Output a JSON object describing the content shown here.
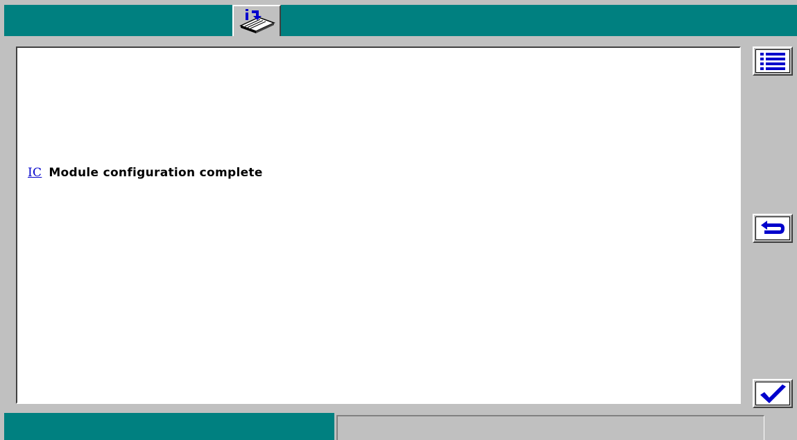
{
  "header": {
    "tab_icon": "info-book-icon"
  },
  "message": {
    "code": "IC",
    "text": "Module configuration complete"
  },
  "side_buttons": [
    {
      "icon": "list-icon"
    },
    {
      "icon": "back-arrow-icon"
    },
    {
      "icon": "checkmark-icon"
    }
  ],
  "status": {
    "left_text": "",
    "right_text": ""
  },
  "colors": {
    "teal": "#008080",
    "gray": "#c0c0c0",
    "link_blue": "#0000cc"
  }
}
